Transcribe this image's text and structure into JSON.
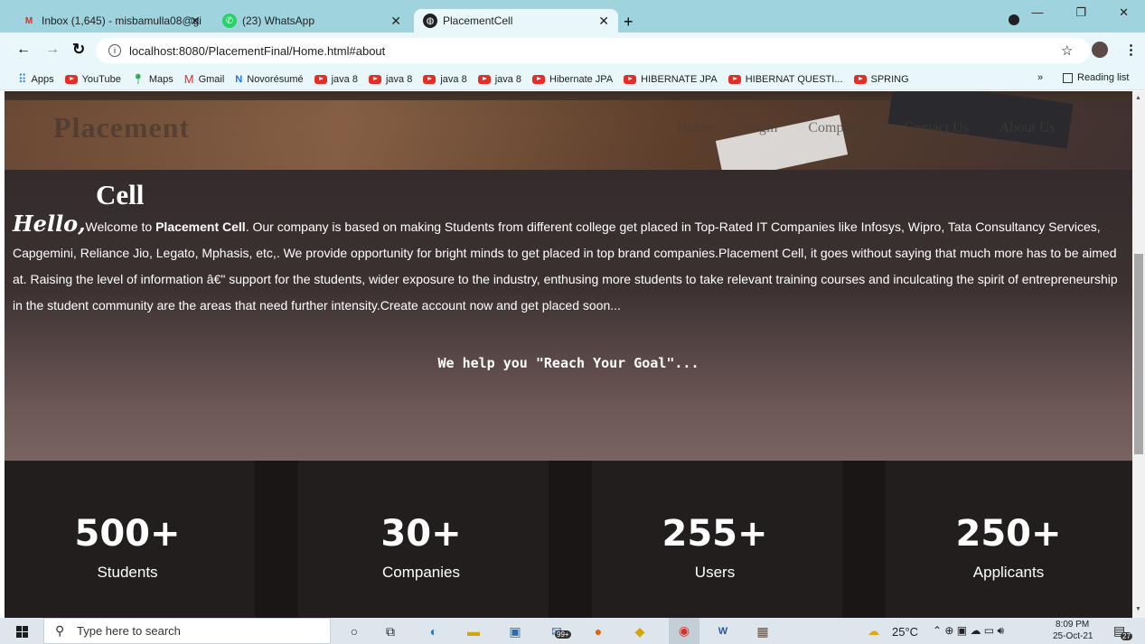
{
  "browser": {
    "tabs": [
      {
        "label": "Inbox (1,645) - misbamulla08@gi",
        "icon": "gmail-icon"
      },
      {
        "label": "(23) WhatsApp",
        "icon": "whatsapp-icon"
      },
      {
        "label": "PlacementCell",
        "icon": "globe-icon"
      }
    ],
    "new_tab": "+",
    "close": "✕",
    "url": "localhost:8080/PlacementFinal/Home.html#about",
    "bookmarks": [
      {
        "label": "Apps",
        "icon": "apps-icon"
      },
      {
        "label": "YouTube",
        "icon": "youtube-icon"
      },
      {
        "label": "Maps",
        "icon": "maps-icon"
      },
      {
        "label": "Gmail",
        "icon": "gmail-icon"
      },
      {
        "label": "Novorésumé",
        "icon": "novoresume-icon"
      },
      {
        "label": "java 8",
        "icon": "youtube-icon"
      },
      {
        "label": "java 8",
        "icon": "youtube-icon"
      },
      {
        "label": "java 8",
        "icon": "youtube-icon"
      },
      {
        "label": "java 8",
        "icon": "youtube-icon"
      },
      {
        "label": "Hibernate JPA",
        "icon": "youtube-icon"
      },
      {
        "label": "HIBERNATE JPA",
        "icon": "youtube-icon"
      },
      {
        "label": "HIBERNAT QUESTI...",
        "icon": "youtube-icon"
      },
      {
        "label": "SPRING",
        "icon": "youtube-icon"
      }
    ],
    "more": "»",
    "reading_list": "Reading list"
  },
  "page": {
    "logo": "Placement",
    "nav": [
      "Home",
      "Login",
      "Companies",
      "Contact Us",
      "About Us"
    ],
    "about": {
      "title": "Cell",
      "hello": "Hello,",
      "intro_1": "Welcome to ",
      "brand": "Placement Cell",
      "body": ". Our company is based on making Students from different college get placed in Top-Rated IT Companies like Infosys, Wipro, Tata Consultancy Services, Capgemini, Reliance Jio, Legato, Mphasis, etc,. We provide opportunity for bright minds to get placed in top brand companies.Placement Cell, it goes without saying that much more has to be aimed at. Raising the level of information â€\" support for the students, wider exposure to the industry, enthusing more students to take relevant training courses and inculcating the spirit of entrepreneurship in the student community are the areas that need further intensity.Create account now and get placed soon...",
      "goal": "We help you \"Reach Your Goal\"..."
    },
    "stats": [
      {
        "value": "500+",
        "label": "Students"
      },
      {
        "value": "30+",
        "label": "Companies"
      },
      {
        "value": "255+",
        "label": "Users"
      },
      {
        "value": "250+",
        "label": "Applicants"
      }
    ]
  },
  "taskbar": {
    "search_placeholder": "Type here to search",
    "weather": "25°C",
    "time": "8:09 PM",
    "date": "25-Oct-21",
    "notifications": "27",
    "badge": "99+"
  }
}
